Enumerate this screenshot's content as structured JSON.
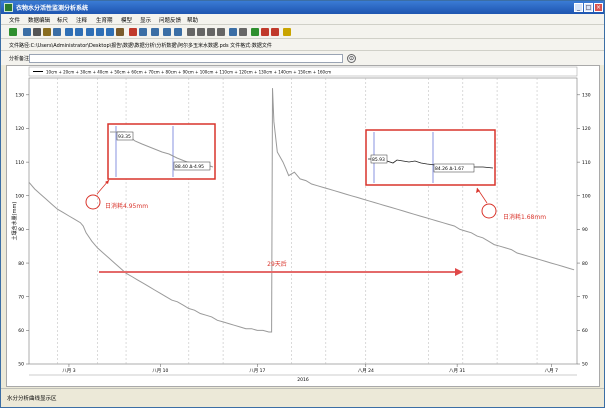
{
  "window": {
    "title": "衣物水分活性监测分析系统"
  },
  "menu": [
    "文件",
    "数据编辑",
    "标尺",
    "注释",
    "生育期",
    "模型",
    "显示",
    "问题反馈",
    "帮助"
  ],
  "toolbar_icons": [
    "open-icon",
    "save-icon",
    "print-icon",
    "copy-icon",
    "filter-icon",
    "zoom-in-icon",
    "zoom-out-icon",
    "zoom-x-icon",
    "zoom-y-icon",
    "zoom-fit-icon",
    "binoculars-icon",
    "chart-red-icon",
    "chart-blue-icon",
    "table-icon",
    "save2-icon",
    "export-icon",
    "grid-icon",
    "line-chart-icon",
    "area-chart-icon",
    "timeline-icon",
    "clock-icon",
    "settings-icon",
    "arrow-left-icon",
    "arrow-right-icon",
    "flag-icon",
    "lightbulb-icon"
  ],
  "filebar": {
    "label": "文件路径:C:\\Users\\Administrator\\Desktop\\报告\\数据\\数据分析\\分析数据\\阿尔多玉米水数据.pds    文件格式:数据文件"
  },
  "note": {
    "label": "分析备注:",
    "value": "",
    "go": "⊙"
  },
  "status": {
    "text": "水分分析曲线显示区"
  },
  "chart_data": {
    "type": "line",
    "legend": "10cm + 20cm + 30cm + 40cm + 50cm + 60cm + 70cm + 80cm + 90cm + 100cm + 110cm + 120cm + 130cm + 140cm + 150cm + 160cm",
    "ylabel": "土壤含水量(mm)",
    "xlabel": "2016",
    "ylim": [
      50,
      135
    ],
    "yticks": [
      50,
      60,
      70,
      80,
      90,
      100,
      110,
      120,
      130
    ],
    "xticks": [
      "八月 3",
      "八月 10",
      "八月 17",
      "八月 24",
      "八月 31",
      "八月 7"
    ],
    "grid": "vertical-dashed",
    "series": [
      {
        "points": [
          [
            0,
            104
          ],
          [
            2,
            102
          ],
          [
            4,
            100.5
          ],
          [
            6,
            99
          ],
          [
            8,
            97.5
          ],
          [
            10,
            96
          ],
          [
            12,
            95
          ],
          [
            14,
            94
          ],
          [
            16,
            93
          ],
          [
            18,
            92
          ],
          [
            19,
            91
          ],
          [
            20,
            89
          ],
          [
            22,
            86.5
          ],
          [
            24,
            84.5
          ],
          [
            26,
            83
          ],
          [
            28,
            81.5
          ],
          [
            30,
            80
          ],
          [
            32,
            78.5
          ],
          [
            34,
            77
          ],
          [
            36,
            76
          ],
          [
            38,
            75
          ],
          [
            40,
            74
          ],
          [
            42,
            73
          ],
          [
            44,
            72
          ],
          [
            46,
            71
          ],
          [
            48,
            70
          ],
          [
            50,
            69
          ],
          [
            52,
            68.5
          ],
          [
            54,
            67.5
          ],
          [
            56,
            66.5
          ],
          [
            58,
            66
          ],
          [
            60,
            65
          ],
          [
            62,
            64.5
          ],
          [
            64,
            64
          ],
          [
            66,
            63
          ],
          [
            68,
            62.5
          ],
          [
            70,
            62
          ],
          [
            72,
            61.5
          ],
          [
            74,
            61
          ],
          [
            76,
            60.5
          ],
          [
            78,
            60.5
          ],
          [
            80,
            60
          ],
          [
            82,
            60
          ],
          [
            84,
            59.5
          ],
          [
            85,
            59.5
          ],
          [
            85.3,
            132
          ],
          [
            85.8,
            122
          ],
          [
            87,
            113
          ],
          [
            89,
            110
          ],
          [
            90,
            108
          ],
          [
            91,
            106
          ],
          [
            93,
            107
          ],
          [
            95,
            105
          ],
          [
            97,
            104.5
          ],
          [
            99,
            103.5
          ],
          [
            101,
            103
          ],
          [
            103,
            102.5
          ],
          [
            105,
            102
          ],
          [
            107,
            101.5
          ],
          [
            109,
            101
          ],
          [
            111,
            100.5
          ],
          [
            113,
            100
          ],
          [
            115,
            99.5
          ],
          [
            117,
            99
          ],
          [
            119,
            98.5
          ],
          [
            121,
            98
          ],
          [
            123,
            97.5
          ],
          [
            125,
            97
          ],
          [
            127,
            96.5
          ],
          [
            129,
            96
          ],
          [
            131,
            95.5
          ],
          [
            133,
            95
          ],
          [
            135,
            94.5
          ],
          [
            137,
            94
          ],
          [
            139,
            93.5
          ],
          [
            141,
            93
          ],
          [
            143,
            92.5
          ],
          [
            145,
            92
          ],
          [
            147,
            91.5
          ],
          [
            149,
            91
          ],
          [
            151,
            90
          ],
          [
            153,
            89.5
          ],
          [
            155,
            89
          ],
          [
            157,
            88
          ],
          [
            159,
            87.5
          ],
          [
            161,
            86.5
          ],
          [
            163,
            85.5
          ],
          [
            165,
            85
          ],
          [
            167,
            84.5
          ],
          [
            169,
            84
          ],
          [
            171,
            83
          ],
          [
            173,
            82.5
          ],
          [
            175,
            82
          ],
          [
            177,
            81.5
          ],
          [
            179,
            81
          ],
          [
            181,
            80.5
          ],
          [
            183,
            80
          ],
          [
            185,
            79.5
          ],
          [
            187,
            79
          ],
          [
            189,
            78.5
          ],
          [
            191,
            78
          ]
        ]
      }
    ],
    "annotations": [
      {
        "text": "日消耗4.95mm",
        "color": "#d9342b"
      },
      {
        "text": "日消耗1.68mm",
        "color": "#d9342b"
      },
      {
        "text": "29天后",
        "color": "#d9342b"
      }
    ],
    "zoom_boxes": [
      {
        "start_label": "93.35",
        "end_label": "88.40 Δ-4.95"
      },
      {
        "start_label": "85.93",
        "end_label": "84.26 Δ-1.67"
      }
    ]
  },
  "colors": {
    "series": "#9a9a9a",
    "highlight": "#d9342b",
    "marker": "#6a78d8"
  }
}
